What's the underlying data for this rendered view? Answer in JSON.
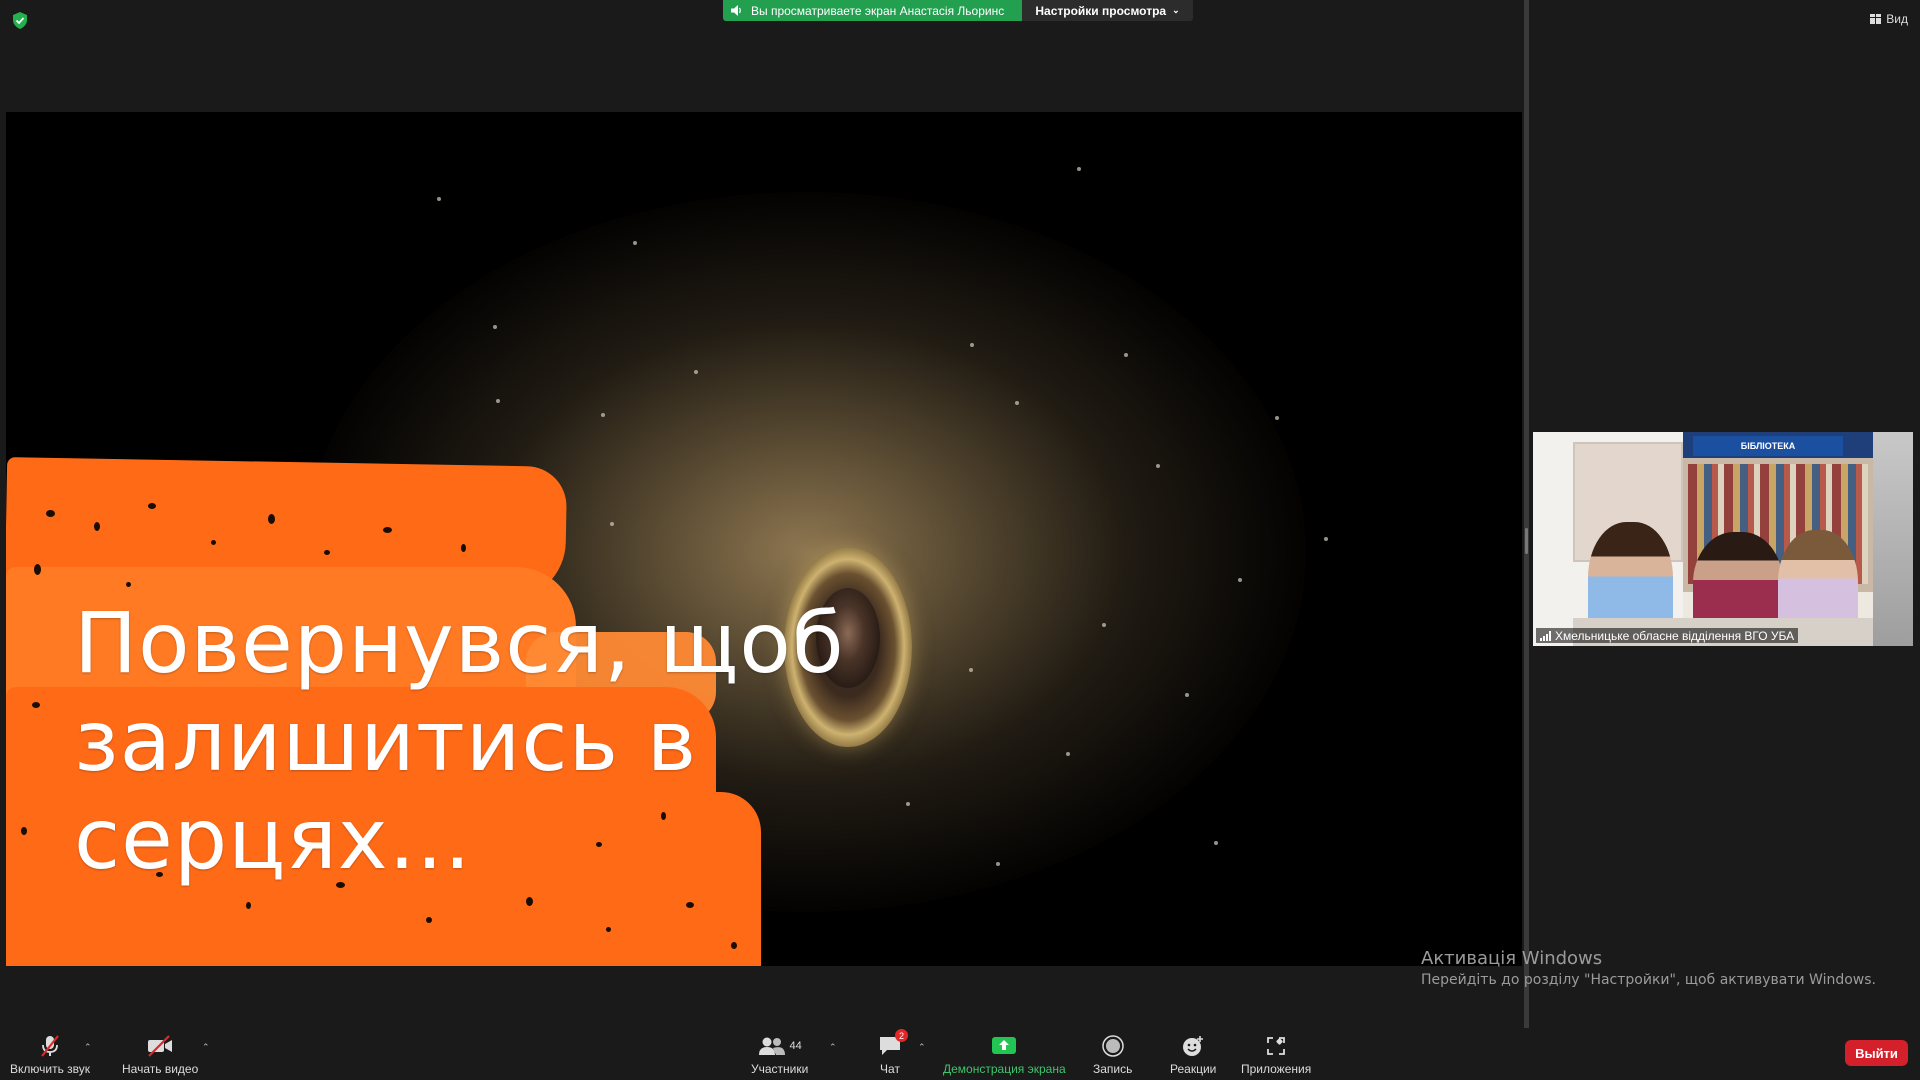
{
  "topbar": {
    "share_banner_text": "Вы просматриваете экран Анастасія Льоринс",
    "view_options_label": "Настройки просмотра",
    "view_button_label": "Вид"
  },
  "shared_screen": {
    "headline_line1": "Повернувся, щоб",
    "headline_line2": "залишитись в",
    "headline_line3": "серцях..."
  },
  "participant": {
    "name": "Хмельницьке обласне відділення ВГО УБА",
    "background_banner": "БІБЛІОТЕКА"
  },
  "watermark": {
    "title": "Активація Windows",
    "subtitle": "Перейдіть до розділу \"Настройки\", щоб активувати Windows."
  },
  "toolbar": {
    "mute_label": "Включить звук",
    "video_label": "Начать видео",
    "participants_label": "Участники",
    "participants_count": "44",
    "chat_label": "Чат",
    "chat_badge": "2",
    "share_label": "Демонстрация экрана",
    "record_label": "Запись",
    "reactions_label": "Реакции",
    "apps_label": "Приложения",
    "leave_label": "Выйти"
  },
  "colors": {
    "share_green": "#23a04f",
    "leave_red": "#d4202b",
    "brush_orange": "#ff6a17",
    "background": "#1a1a1a"
  }
}
